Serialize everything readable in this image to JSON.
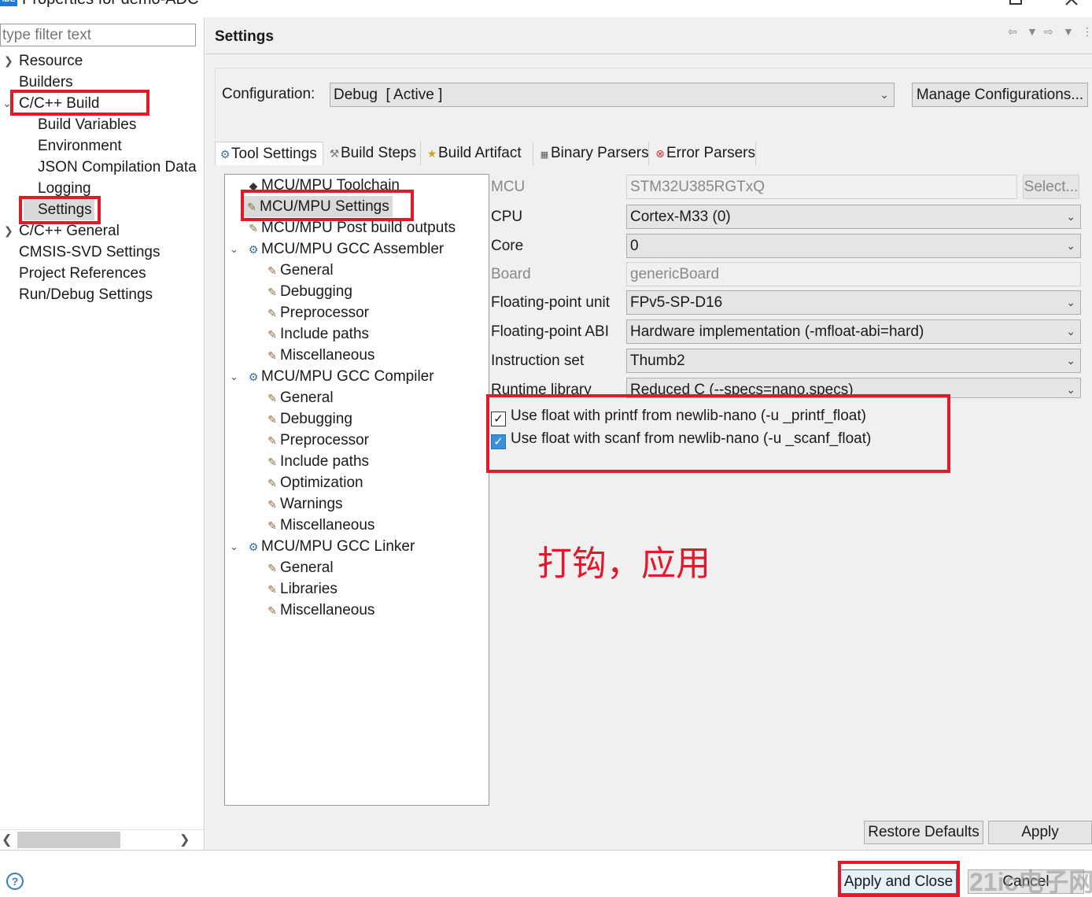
{
  "window": {
    "title": "Properties for demo-ADC",
    "app_icon": "IDE"
  },
  "filter": {
    "placeholder": "type filter text"
  },
  "nav": {
    "items": [
      {
        "label": "Resource"
      },
      {
        "label": "Builders"
      },
      {
        "label": "C/C++ Build"
      },
      {
        "label": "Build Variables"
      },
      {
        "label": "Environment"
      },
      {
        "label": "JSON Compilation Database"
      },
      {
        "label": "Logging"
      },
      {
        "label": "Settings"
      },
      {
        "label": "C/C++ General"
      },
      {
        "label": "CMSIS-SVD Settings"
      },
      {
        "label": "Project References"
      },
      {
        "label": "Run/Debug Settings"
      }
    ]
  },
  "header": {
    "title": "Settings"
  },
  "configuration": {
    "label": "Configuration:",
    "value": "Debug  [ Active ]",
    "manage_label": "Manage Configurations..."
  },
  "tabs": [
    {
      "label": "Tool Settings",
      "icon": "gear-icon"
    },
    {
      "label": "Build Steps",
      "icon": "wrench-icon"
    },
    {
      "label": "Build Artifact",
      "icon": "trophy-icon"
    },
    {
      "label": "Binary Parsers",
      "icon": "binary-icon"
    },
    {
      "label": "Error Parsers",
      "icon": "error-icon"
    }
  ],
  "tree": {
    "items": [
      {
        "label": "MCU/MPU Toolchain"
      },
      {
        "label": "MCU/MPU Settings"
      },
      {
        "label": "MCU/MPU Post build outputs"
      },
      {
        "label": "MCU/MPU GCC Assembler"
      },
      {
        "label": "General"
      },
      {
        "label": "Debugging"
      },
      {
        "label": "Preprocessor"
      },
      {
        "label": "Include paths"
      },
      {
        "label": "Miscellaneous"
      },
      {
        "label": "MCU/MPU GCC Compiler"
      },
      {
        "label": "General"
      },
      {
        "label": "Debugging"
      },
      {
        "label": "Preprocessor"
      },
      {
        "label": "Include paths"
      },
      {
        "label": "Optimization"
      },
      {
        "label": "Warnings"
      },
      {
        "label": "Miscellaneous"
      },
      {
        "label": "MCU/MPU GCC Linker"
      },
      {
        "label": "General"
      },
      {
        "label": "Libraries"
      },
      {
        "label": "Miscellaneous"
      }
    ]
  },
  "form": {
    "mcu": {
      "label": "MCU",
      "value": "STM32U385RGTxQ",
      "select_label": "Select..."
    },
    "cpu": {
      "label": "CPU",
      "value": "Cortex-M33 (0)"
    },
    "core": {
      "label": "Core",
      "value": "0"
    },
    "board": {
      "label": "Board",
      "value": "genericBoard"
    },
    "fpu": {
      "label": "Floating-point unit",
      "value": "FPv5-SP-D16"
    },
    "fabi": {
      "label": "Floating-point ABI",
      "value": "Hardware implementation (-mfloat-abi=hard)"
    },
    "iset": {
      "label": "Instruction set",
      "value": "Thumb2"
    },
    "runtime": {
      "label": "Runtime library",
      "value": "Reduced C (--specs=nano.specs)"
    },
    "printf_float": {
      "label": "Use float with printf from newlib-nano (-u _printf_float)",
      "checked": true
    },
    "scanf_float": {
      "label": "Use float with scanf from newlib-nano (-u _scanf_float)",
      "checked": true
    }
  },
  "buttons": {
    "restore": "Restore Defaults",
    "apply": "Apply",
    "apply_close": "Apply and Close",
    "cancel": "Cancel"
  },
  "annotation": {
    "note": "打钩，应用"
  },
  "watermark": "21ic电子网",
  "colors": {
    "annotation_red": "#e5182a",
    "accent_blue": "#2f6fb5"
  }
}
